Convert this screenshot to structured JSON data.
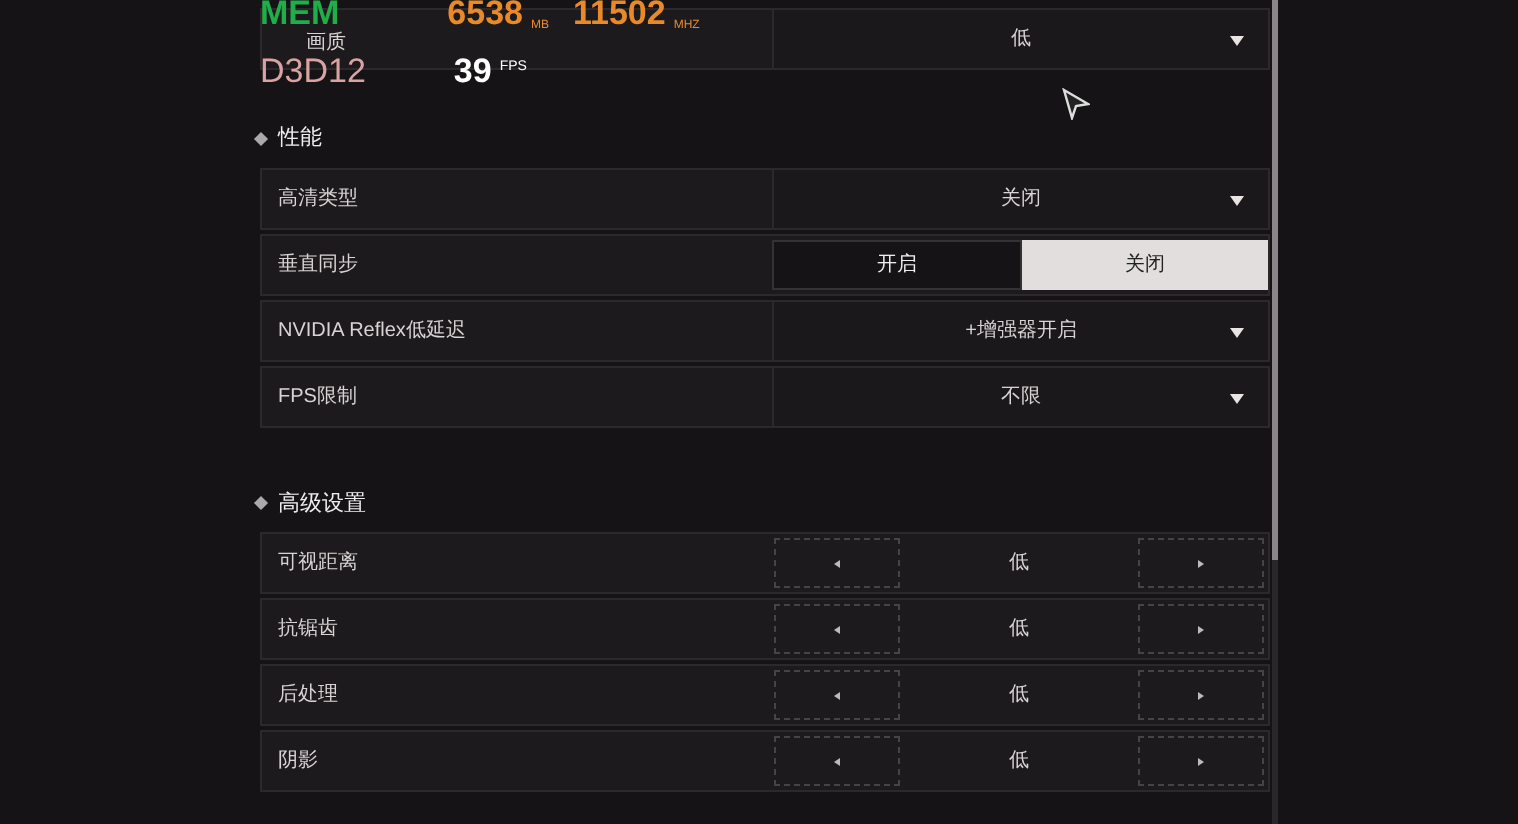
{
  "overlay": {
    "mem_label": "MEM",
    "mem_value": "6538",
    "mem_unit": "MB",
    "clock_value": "11502",
    "clock_unit": "MHZ",
    "api": "D3D12",
    "fps_value": "39",
    "fps_unit": "FPS"
  },
  "top_row": {
    "kind": "dropdown",
    "label": "画质",
    "value": "低"
  },
  "sections": [
    {
      "title": "性能",
      "rows": [
        {
          "kind": "dropdown",
          "label": "高清类型",
          "value": "关闭"
        },
        {
          "kind": "toggle",
          "label": "垂直同步",
          "options": [
            {
              "label": "开启",
              "selected": false
            },
            {
              "label": "关闭",
              "selected": true
            }
          ]
        },
        {
          "kind": "dropdown",
          "label": "NVIDIA Reflex低延迟",
          "value": "+增强器开启"
        },
        {
          "kind": "dropdown",
          "label": "FPS限制",
          "value": "不限"
        }
      ]
    },
    {
      "title": "高级设置",
      "rows": [
        {
          "kind": "stepper",
          "label": "可视距离",
          "value": "低"
        },
        {
          "kind": "stepper",
          "label": "抗锯齿",
          "value": "低"
        },
        {
          "kind": "stepper",
          "label": "后处理",
          "value": "低"
        },
        {
          "kind": "stepper",
          "label": "阴影",
          "value": "低"
        }
      ]
    }
  ]
}
